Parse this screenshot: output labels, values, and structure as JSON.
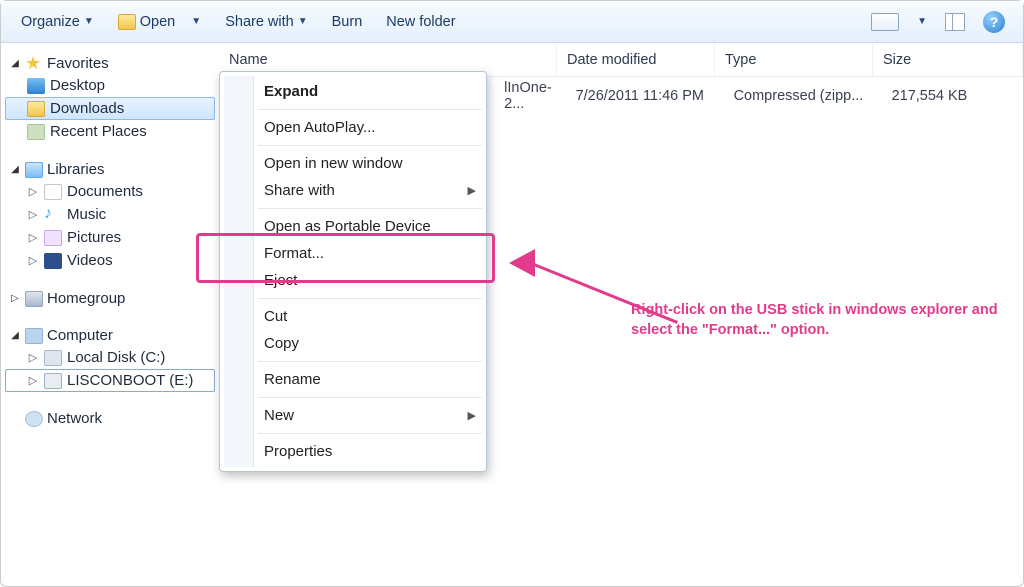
{
  "toolbar": {
    "organize": "Organize",
    "open": "Open",
    "share": "Share with",
    "burn": "Burn",
    "newfolder": "New folder"
  },
  "nav": {
    "favorites": {
      "label": "Favorites",
      "desktop": "Desktop",
      "downloads": "Downloads",
      "recent": "Recent Places"
    },
    "libraries": {
      "label": "Libraries",
      "documents": "Documents",
      "music": "Music",
      "pictures": "Pictures",
      "videos": "Videos"
    },
    "homegroup": "Homegroup",
    "computer": {
      "label": "Computer",
      "localc": "Local Disk (C:)",
      "lisconboot": "LISCONBOOT (E:)"
    },
    "network": "Network"
  },
  "columns": {
    "name": "Name",
    "date": "Date modified",
    "type": "Type",
    "size": "Size"
  },
  "file": {
    "name_visible": "lInOne-2...",
    "date": "7/26/2011 11:46 PM",
    "type": "Compressed (zipp...",
    "size": "217,554 KB"
  },
  "menu": {
    "expand": "Expand",
    "autoplay": "Open AutoPlay...",
    "openwin": "Open in new window",
    "sharewith": "Share with",
    "portable": "Open as Portable Device",
    "format": "Format...",
    "eject": "Eject",
    "cut": "Cut",
    "copy": "Copy",
    "rename": "Rename",
    "new": "New",
    "properties": "Properties"
  },
  "annotation": "Right-click on the USB stick in windows explorer and select the \"Format...\" option."
}
